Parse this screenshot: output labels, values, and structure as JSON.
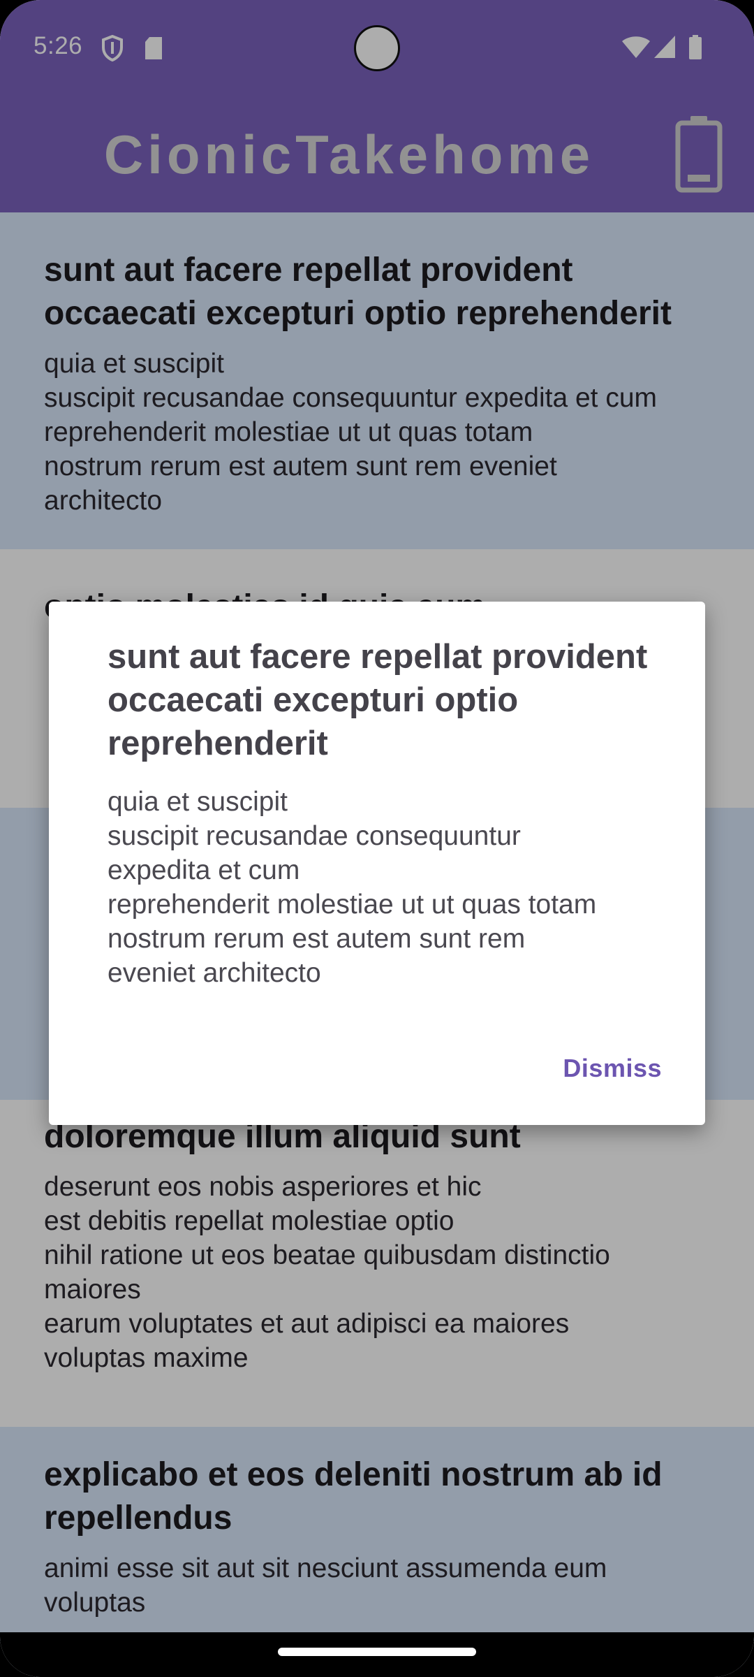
{
  "status_bar": {
    "time": "5:26",
    "icons": [
      "shield-icon",
      "sd-card-icon",
      "wifi-icon",
      "cellular-signal-icon",
      "battery-icon"
    ]
  },
  "app_bar": {
    "title": "CionicTakehome",
    "action_icon": "battery-icon"
  },
  "posts": [
    {
      "title": "sunt aut facere repellat provident occaecati excepturi optio reprehenderit",
      "body": "quia et suscipit\nsuscipit recusandae consequuntur expedita et cum\nreprehenderit molestiae ut ut quas totam\nnostrum rerum est autem sunt rem eveniet\narchitecto"
    },
    {
      "title": "optio molestias id quia eum",
      "body": ""
    },
    {
      "title": "",
      "body": ""
    },
    {
      "title": "doloremque illum aliquid sunt",
      "body": "deserunt eos nobis asperiores et hic\nest debitis repellat molestiae optio\nnihil ratione ut eos beatae quibusdam distinctio\nmaiores\nearum voluptates et aut adipisci ea maiores\nvoluptas maxime"
    },
    {
      "title": "explicabo et eos deleniti nostrum ab id repellendus",
      "body": "animi esse sit aut sit nesciunt assumenda eum\nvoluptas"
    }
  ],
  "dialog": {
    "title": "sunt aut facere repellat provident occaecati excepturi optio reprehenderit",
    "body": "quia et suscipit\nsuscipit recusandae consequuntur\nexpedita et cum\nreprehenderit molestiae ut ut quas totam\nnostrum rerum est autem sunt rem\neveniet architecto",
    "dismiss_label": "Dismiss"
  },
  "colors": {
    "app_bar": "#7b62bd",
    "card_alt": "#d9e7fb",
    "accent": "#6c55b0"
  }
}
